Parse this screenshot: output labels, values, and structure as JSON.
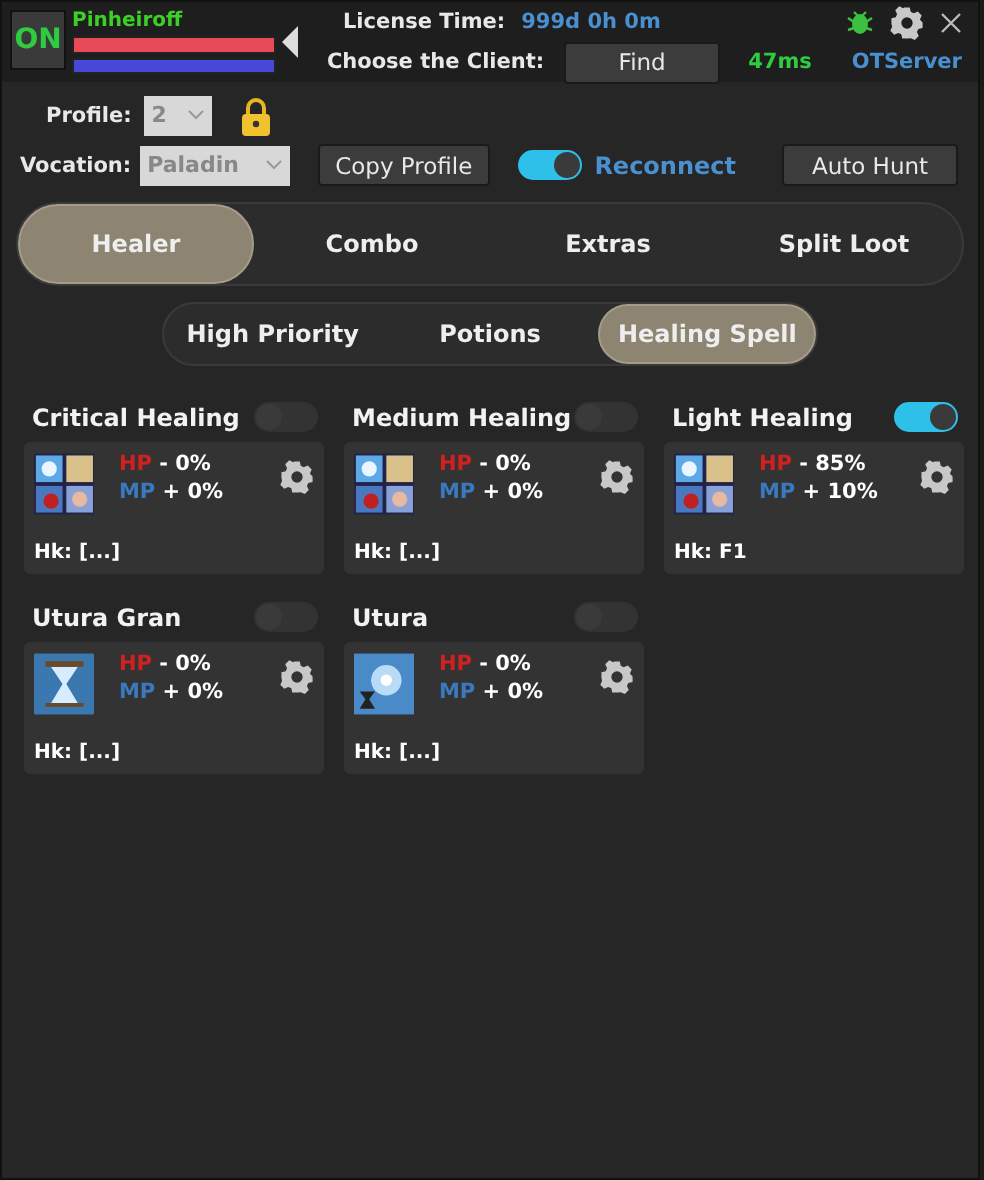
{
  "header": {
    "power": {
      "label": "ON",
      "on": true
    },
    "character": "Pinheiroff",
    "health": {
      "level": 1
    },
    "mana": {
      "level": 1
    },
    "license_label": "License Time:",
    "license_time": "999d 0h 0m",
    "client_label": "Choose the Client:",
    "find_button": "Find",
    "ping": "47ms",
    "server": "OTServer"
  },
  "profile": {
    "label": "Profile:",
    "value": "2",
    "locked": true
  },
  "vocation": {
    "label": "Vocation:",
    "value": "Paladin"
  },
  "copy_button": "Copy Profile",
  "reconnect": {
    "label": "Reconnect",
    "on": true
  },
  "auto_hunt_button": "Auto Hunt",
  "tabs": [
    {
      "label": "Healer",
      "selected": true
    },
    {
      "label": "Combo",
      "selected": false
    },
    {
      "label": "Extras",
      "selected": false
    },
    {
      "label": "Split Loot",
      "selected": false
    }
  ],
  "subtabs": [
    {
      "label": "High Priority",
      "selected": false
    },
    {
      "label": "Potions",
      "selected": false
    },
    {
      "label": "Healing Spell",
      "selected": true
    }
  ],
  "spells": [
    {
      "name": "Critical Healing",
      "on": false,
      "kind": "quad",
      "hp_label": "HP",
      "hp_value": "- 0%",
      "mp_label": "MP",
      "mp_value": "+ 0%",
      "hotkey": "Hk: [...]"
    },
    {
      "name": "Medium Healing",
      "on": false,
      "kind": "quad",
      "hp_label": "HP",
      "hp_value": "- 0%",
      "mp_label": "MP",
      "mp_value": "+ 0%",
      "hotkey": "Hk: [...]"
    },
    {
      "name": "Light Healing",
      "on": true,
      "kind": "quad",
      "hp_label": "HP",
      "hp_value": "- 85%",
      "mp_label": "MP",
      "mp_value": "+ 10%",
      "hotkey": "Hk: F1"
    },
    {
      "name": "Utura Gran",
      "on": false,
      "kind": "hourglass",
      "hp_label": "HP",
      "hp_value": "- 0%",
      "mp_label": "MP",
      "mp_value": "+ 0%",
      "hotkey": "Hk: [...]"
    },
    {
      "name": "Utura",
      "on": false,
      "kind": "rune",
      "hp_label": "HP",
      "hp_value": "- 0%",
      "mp_label": "MP",
      "mp_value": "+ 0%",
      "hotkey": "Hk: [...]"
    }
  ]
}
